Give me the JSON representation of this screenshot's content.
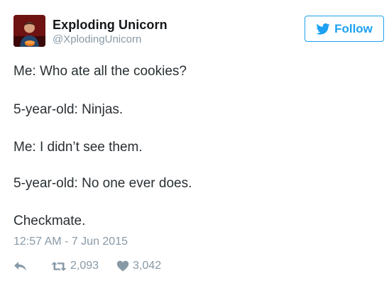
{
  "user": {
    "display_name": "Exploding Unicorn",
    "handle": "@XplodingUnicorn",
    "avatar_icon": "user-avatar"
  },
  "follow_button": {
    "label": "Follow",
    "icon": "twitter-bird-icon",
    "color": "#1da1f2"
  },
  "tweet": {
    "lines": [
      "Me: Who ate all the cookies?",
      "5-year-old: Ninjas.",
      "Me: I didn’t see them.",
      "5-year-old: No one ever does.",
      "Checkmate."
    ],
    "timestamp": "12:57 AM - 7 Jun 2015"
  },
  "actions": {
    "reply_icon": "reply-icon",
    "retweet_icon": "retweet-icon",
    "retweet_count": "2,093",
    "like_icon": "heart-icon",
    "like_count": "3,042"
  },
  "colors": {
    "text": "#292f33",
    "muted": "#8899a6",
    "accent": "#1da1f2"
  }
}
